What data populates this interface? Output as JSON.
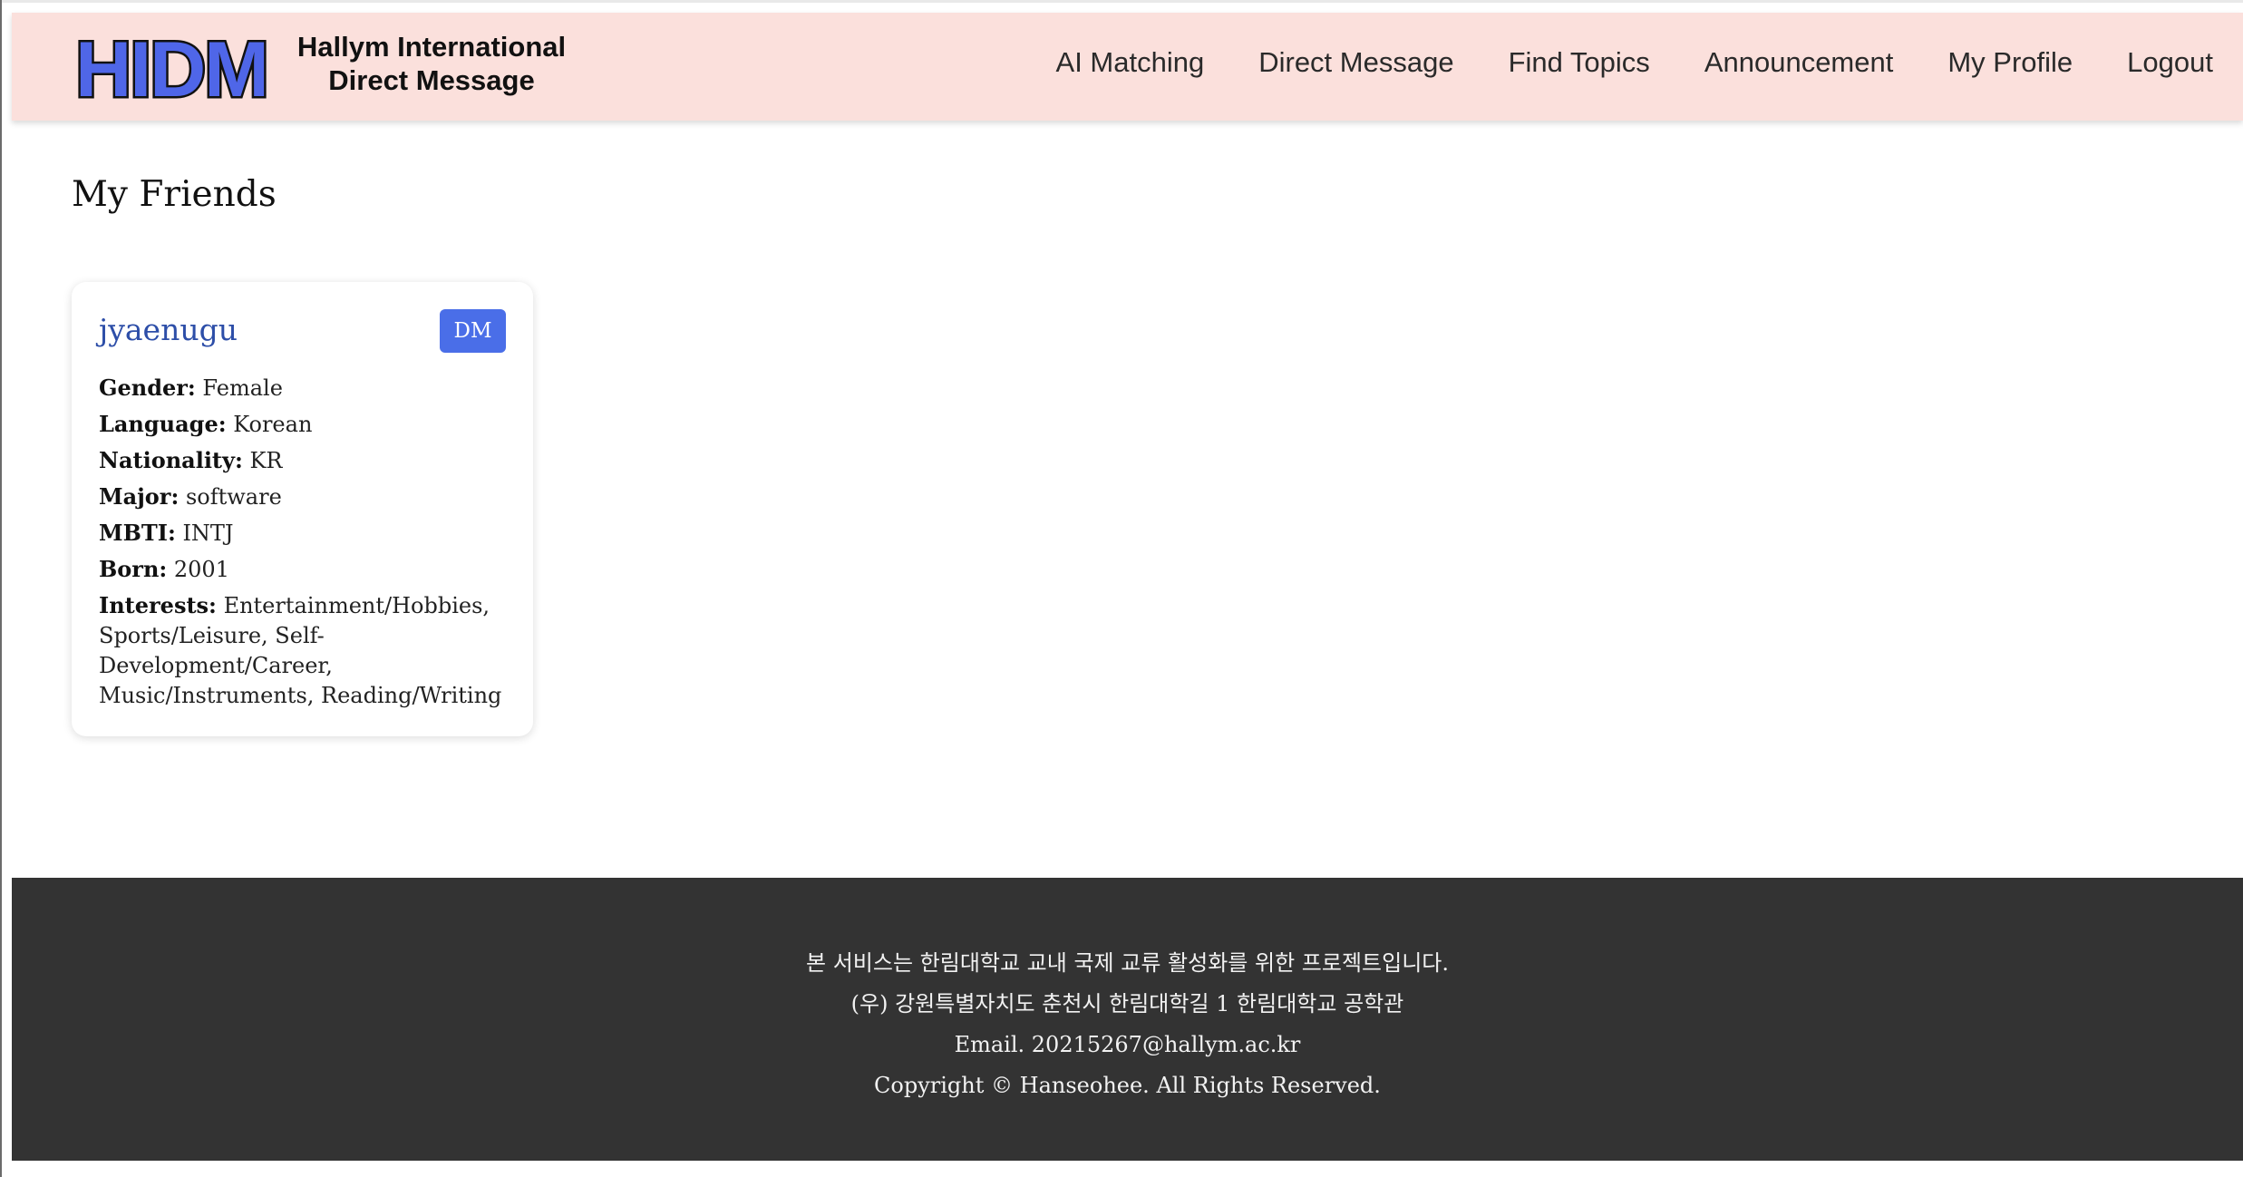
{
  "brand": {
    "logo": "HIDM",
    "name_line1": "Hallym International",
    "name_line2": "Direct Message",
    "logo_fill": "#4f66e8"
  },
  "nav": {
    "items": [
      "AI Matching",
      "Direct Message",
      "Find Topics",
      "Announcement",
      "My Profile",
      "Logout"
    ]
  },
  "main": {
    "title": "My Friends",
    "friends": [
      {
        "name": "jyaenugu",
        "dm_label": "DM",
        "fields": [
          {
            "label": "Gender:",
            "value": "Female"
          },
          {
            "label": "Language:",
            "value": "Korean"
          },
          {
            "label": "Nationality:",
            "value": "KR"
          },
          {
            "label": "Major:",
            "value": "software"
          },
          {
            "label": "MBTI:",
            "value": "INTJ"
          },
          {
            "label": "Born:",
            "value": "2001"
          },
          {
            "label": "Interests:",
            "value": "Entertainment/Hobbies, Sports/Leisure, Self-Development/Career, Music/Instruments, Reading/Writing"
          }
        ]
      }
    ]
  },
  "footer": {
    "lines": [
      "본 서비스는 한림대학교 교내 국제 교류 활성화를 위한 프로젝트입니다.",
      "(우) 강원특별자치도 춘천시 한림대학길 1 한림대학교 공학관",
      "Email. 20215267@hallym.ac.kr",
      "Copyright © Hanseohee. All Rights Reserved."
    ]
  },
  "colors": {
    "header_bg": "#fbe0dc",
    "footer_bg": "#333333",
    "accent": "#4a6ee8",
    "friend_name": "#2d4ea8"
  }
}
